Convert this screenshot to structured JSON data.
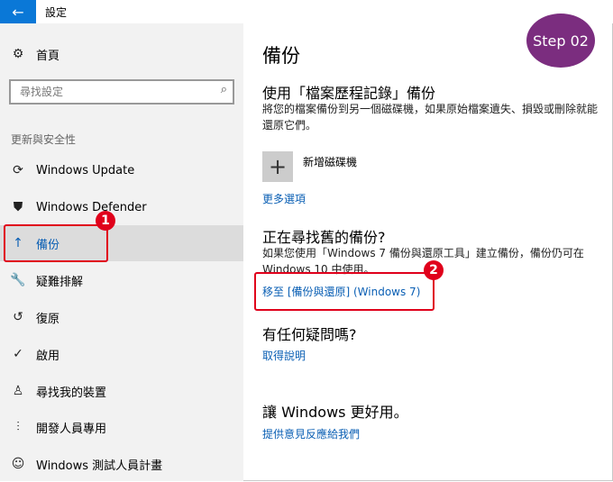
{
  "window": {
    "title": "設定",
    "back_glyph": "←"
  },
  "sidebar": {
    "home": {
      "icon": "gear-icon",
      "glyph": "⚙",
      "label": "首頁"
    },
    "search": {
      "placeholder": "尋找設定",
      "icon": "search-icon",
      "glyph": "⌕"
    },
    "section": "更新與安全性",
    "items": [
      {
        "icon": "refresh-icon",
        "glyph": "⟳",
        "label": "Windows Update"
      },
      {
        "icon": "shield-icon",
        "glyph": "⛊",
        "label": "Windows Defender"
      },
      {
        "icon": "backup-arrow-icon",
        "glyph": "↑",
        "label": "備份",
        "selected": true
      },
      {
        "icon": "wrench-icon",
        "glyph": "🔧",
        "label": "疑難排解"
      },
      {
        "icon": "restore-icon",
        "glyph": "↺",
        "label": "復原"
      },
      {
        "icon": "check-circle-icon",
        "glyph": "✓",
        "label": "啟用"
      },
      {
        "icon": "person-locate-icon",
        "glyph": "♙",
        "label": "尋找我的裝置"
      },
      {
        "icon": "developer-icon",
        "glyph": "⫶",
        "label": "開發人員專用"
      },
      {
        "icon": "insider-icon",
        "glyph": "☺",
        "label": "Windows 測試人員計畫"
      }
    ]
  },
  "main": {
    "title": "備份",
    "file_history": {
      "heading": "使用「檔案歷程記錄」備份",
      "desc": "將您的檔案備份到另一個磁碟機，如果原始檔案遺失、損毀或刪除就能還原它們。",
      "add_drive_label": "新增磁碟機",
      "add_glyph": "+",
      "more_options": "更多選項"
    },
    "older_backup": {
      "heading": "正在尋找舊的備份?",
      "desc": "如果您使用「Windows 7 備份與還原工具」建立備份，備份仍可在 Windows 10 中使用。",
      "link": "移至 [備份與還原] (Windows 7)"
    },
    "questions": {
      "heading": "有任何疑問嗎?",
      "link": "取得說明"
    },
    "better": {
      "heading": "讓 Windows 更好用。",
      "link": "提供意見反應給我們"
    }
  },
  "annotations": {
    "badge1": "1",
    "badge2": "2",
    "step": "Step 02"
  },
  "colors": {
    "accent": "#0a78d7",
    "link": "#0a5fb4",
    "annotation": "#e0001b",
    "step_bg": "#7b2d7f"
  }
}
